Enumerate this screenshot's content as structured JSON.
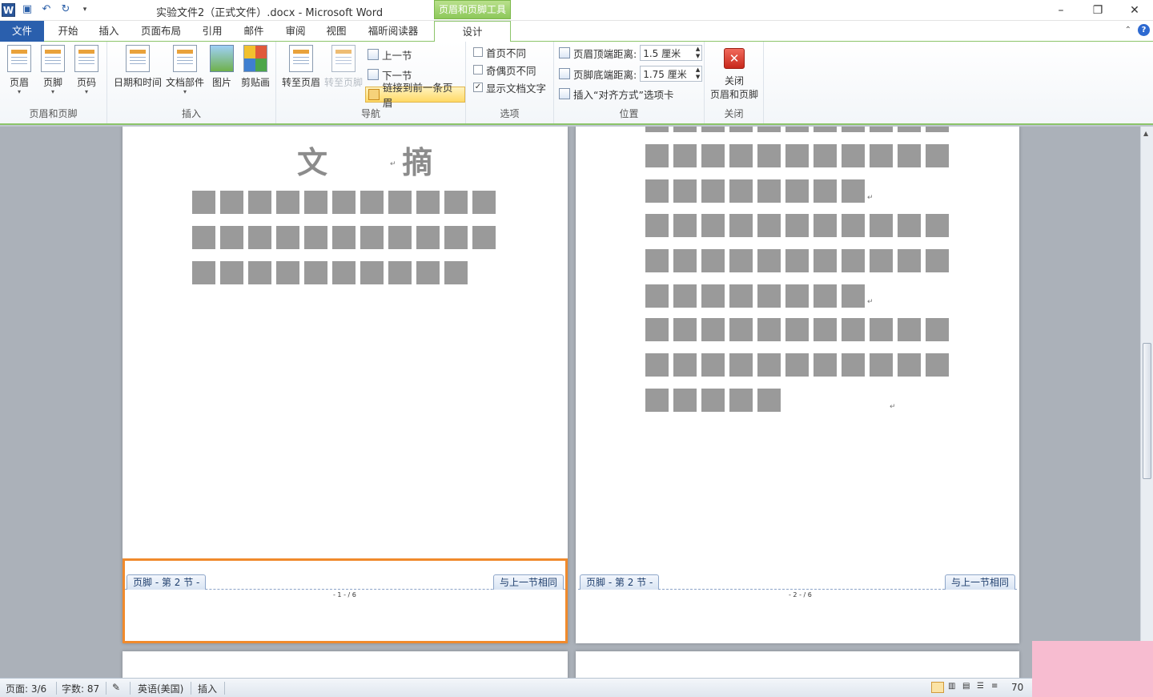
{
  "window": {
    "title": "实验文件2（正式文件）.docx - Microsoft Word",
    "context_group": "页眉和页脚工具",
    "controls": {
      "minimize": "–",
      "restore": "❐",
      "close": "✕"
    }
  },
  "tabs": [
    "文件",
    "开始",
    "插入",
    "页面布局",
    "引用",
    "邮件",
    "审阅",
    "视图",
    "福昕阅读器",
    "设计"
  ],
  "ribbon": {
    "header_footer": {
      "header": "页眉",
      "footer": "页脚",
      "page_number": "页码",
      "label": "页眉和页脚"
    },
    "insert": {
      "date_time": "日期和时间",
      "doc_parts": "文档部件",
      "picture": "图片",
      "clip_art": "剪贴画",
      "label": "插入"
    },
    "navigation": {
      "goto_header": "转至页眉",
      "goto_footer": "转至页脚",
      "prev": "上一节",
      "next": "下一节",
      "link_prev": "链接到前一条页眉",
      "label": "导航"
    },
    "options": {
      "different_first": "首页不同",
      "different_odd_even": "奇偶页不同",
      "show_doc_text": "显示文档文字",
      "show_doc_text_checked": "✓",
      "label": "选项"
    },
    "position": {
      "header_dist_label": "页眉顶端距离:",
      "header_dist": "1.5 厘米",
      "footer_dist_label": "页脚底端距离:",
      "footer_dist": "1.75 厘米",
      "insert_align": "插入“对齐方式”选项卡",
      "label": "位置"
    },
    "close": {
      "close_label": "关闭",
      "close_label2": "页眉和页脚",
      "label": "关闭"
    }
  },
  "document": {
    "page1_heading": "文 摘",
    "footer_tag": "页脚 - 第 2 节 -",
    "same_as_prev": "与上一节相同",
    "page1_number": "- 1 - / 6",
    "page2_number": "- 2 - / 6",
    "para_mark": "↵"
  },
  "status": {
    "page": "页面: 3/6",
    "words": "字数: 87",
    "language": "英语(美国)",
    "mode": "插入",
    "zoom": "70"
  }
}
